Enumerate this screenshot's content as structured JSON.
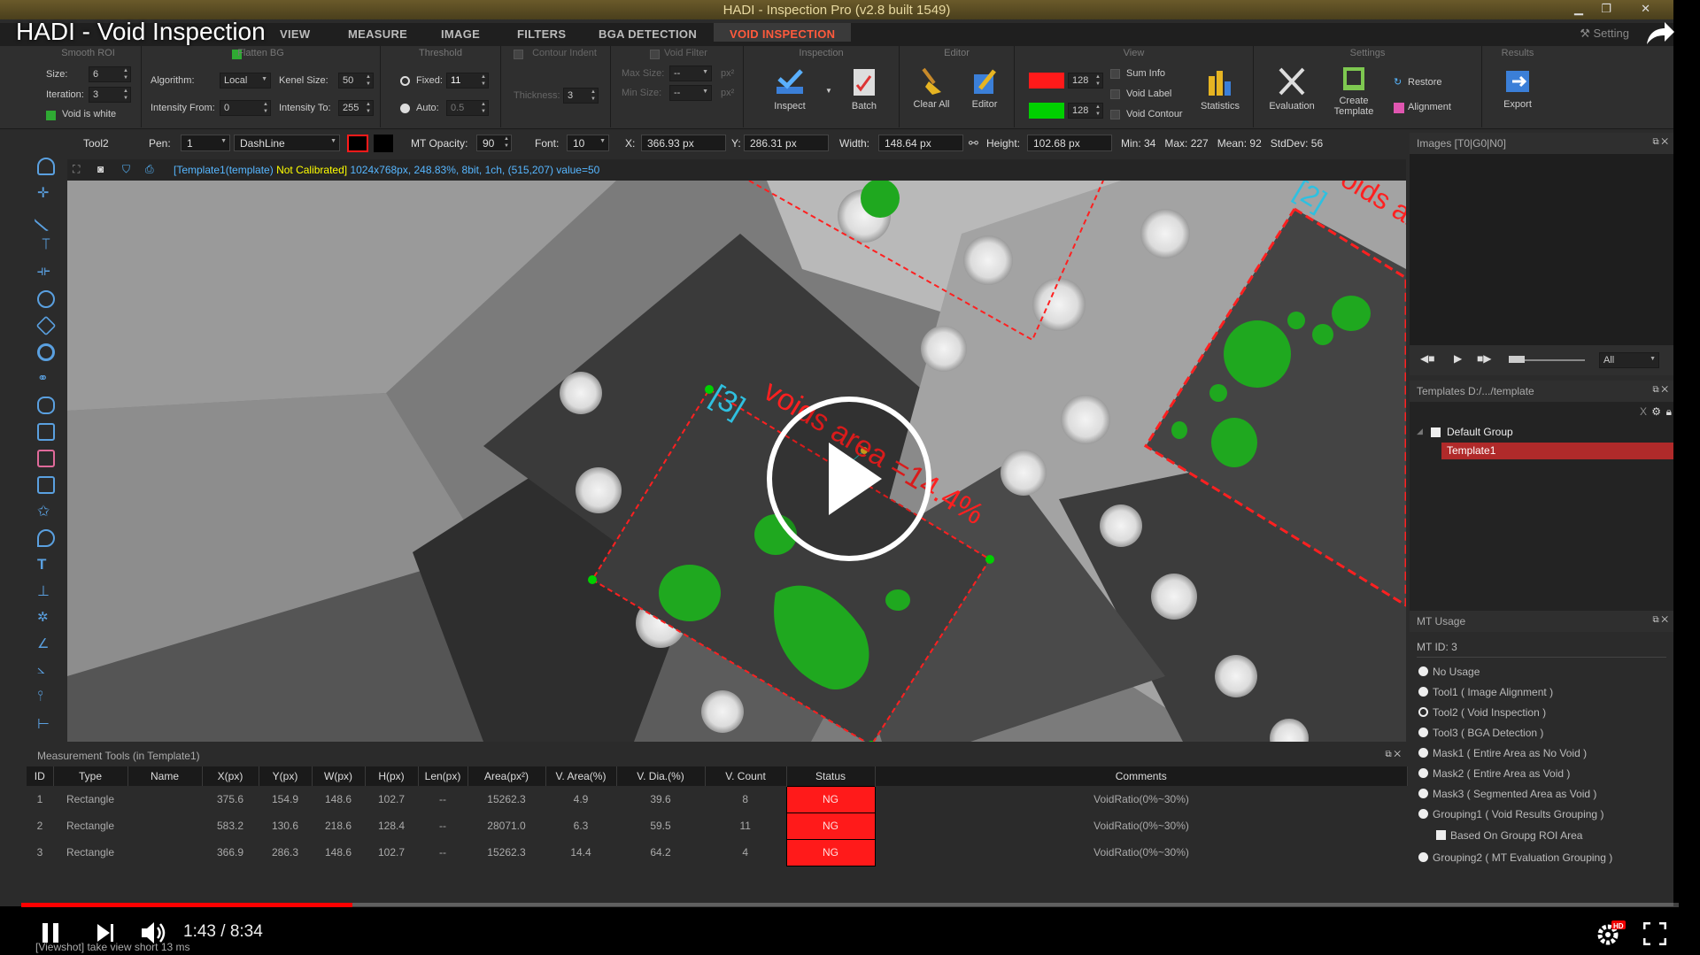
{
  "window": {
    "app_title": "HADI - Inspection Pro (v2.8 built 1549)",
    "video_title": "HADI - Void Inspection"
  },
  "menu": {
    "tabs": [
      "VIEW",
      "MEASURE",
      "IMAGE",
      "FILTERS",
      "BGA DETECTION",
      "VOID INSPECTION"
    ],
    "active": "VOID INSPECTION",
    "setting_label": "Setting"
  },
  "ribbon": {
    "smooth_roi": {
      "title": "Smooth ROI",
      "size_label": "Size:",
      "size": "6",
      "iteration_label": "Iteration:",
      "iteration": "3",
      "void_white_label": "Void is white"
    },
    "flatten": {
      "title": "Flatten BG",
      "algorithm_label": "Algorithm:",
      "algorithm": "Local",
      "kernel_label": "Kenel Size:",
      "kernel": "50",
      "from_label": "Intensity From:",
      "from": "0",
      "to_label": "Intensity To:",
      "to": "255"
    },
    "threshold": {
      "title": "Threshold",
      "fixed_label": "Fixed:",
      "fixed": "11",
      "auto_label": "Auto:",
      "auto": "0.5"
    },
    "contour": {
      "title": "Contour Indent",
      "thickness_label": "Thickness:",
      "thickness": "3"
    },
    "void_filter": {
      "title": "Void Filter",
      "max_label": "Max Size:",
      "max": "--",
      "min_label": "Min Size:",
      "min": "--",
      "unit": "px²"
    },
    "inspection": {
      "title": "Inspection",
      "inspect": "Inspect",
      "batch": "Batch"
    },
    "editor": {
      "title": "Editor",
      "clear_all": "Clear All",
      "editor": "Editor"
    },
    "view": {
      "title": "View",
      "red_value": "128",
      "green_value": "128",
      "sum_info": "Sum Info",
      "void_label": "Void Label",
      "void_contour": "Void Contour",
      "statistics": "Statistics"
    },
    "settings": {
      "title": "Settings",
      "evaluation": "Evaluation",
      "create_template": "Create Template",
      "restore": "Restore",
      "alignment": "Alignment"
    },
    "results": {
      "title": "Results",
      "export": "Export"
    }
  },
  "colors": {
    "accent_red": "#ff1a1a",
    "void_green": "#1fa81f",
    "roi_green": "#00d000",
    "info_blue": "#56b6ff"
  },
  "toolrow": {
    "tool": "Tool2",
    "pen_label": "Pen:",
    "pen": "1",
    "style": "DashLine",
    "opacity_label": "MT Opacity:",
    "opacity": "90",
    "font_label": "Font:",
    "font": "10",
    "x_label": "X:",
    "x": "366.93 px",
    "y_label": "Y:",
    "y": "286.31 px",
    "width_label": "Width:",
    "width": "148.64 px",
    "height_label": "Height:",
    "height": "102.68 px",
    "stats": "Min: 34   Max: 227   Mean: 92   StdDev: 56"
  },
  "canvas": {
    "template_tag": "[Template1(template)",
    "not_calibrated": "Not Calibrated]",
    "image_info": "1024x768px, 248.83%, 8bit, 1ch, (515,207) value=50",
    "roi3_tag": "[3]",
    "roi3_label": "voids area =14.4%",
    "roi2_tag": "[2]",
    "roi2_label": "oids ar"
  },
  "images_panel": {
    "title": "Images [T0|G0|N0]",
    "filter": "All"
  },
  "templates_panel": {
    "title": "Templates D:/.../template",
    "group": "Default Group",
    "item": "Template1"
  },
  "mt_usage": {
    "title": "MT Usage",
    "mt_id": "MT ID:  3",
    "options": [
      "No Usage",
      "Tool1 ( Image Alignment )",
      "Tool2 ( Void Inspection )",
      "Tool3 ( BGA Detection )",
      "Mask1 ( Entire Area as No Void )",
      "Mask2 ( Entire Area as Void )",
      "Mask3 ( Segmented Area as Void )",
      "Grouping1 ( Void Results Grouping )",
      "Based On Groupg ROI Area",
      "Grouping2 ( MT Evaluation Grouping )"
    ],
    "selected_index": 2
  },
  "measurement": {
    "title": "Measurement Tools (in Template1)",
    "headers": [
      "ID",
      "Type",
      "Name",
      "X(px)",
      "Y(px)",
      "W(px)",
      "H(px)",
      "Len(px)",
      "Area(px²)",
      "V. Area(%)",
      "V. Dia.(%)",
      "V. Count",
      "Status",
      "Comments"
    ],
    "rows": [
      [
        "1",
        "Rectangle",
        "",
        "375.6",
        "154.9",
        "148.6",
        "102.7",
        "--",
        "15262.3",
        "4.9",
        "39.6",
        "8",
        "NG",
        "VoidRatio(0%~30%)"
      ],
      [
        "2",
        "Rectangle",
        "",
        "583.2",
        "130.6",
        "218.6",
        "128.4",
        "--",
        "28071.0",
        "6.3",
        "59.5",
        "11",
        "NG",
        "VoidRatio(0%~30%)"
      ],
      [
        "3",
        "Rectangle",
        "",
        "366.9",
        "286.3",
        "148.6",
        "102.7",
        "--",
        "15262.3",
        "14.4",
        "64.2",
        "4",
        "NG",
        "VoidRatio(0%~30%)"
      ]
    ]
  },
  "player": {
    "time": "1:43 / 8:34",
    "progress": 0.2,
    "status": "[Viewshot] take view short 13 ms"
  }
}
